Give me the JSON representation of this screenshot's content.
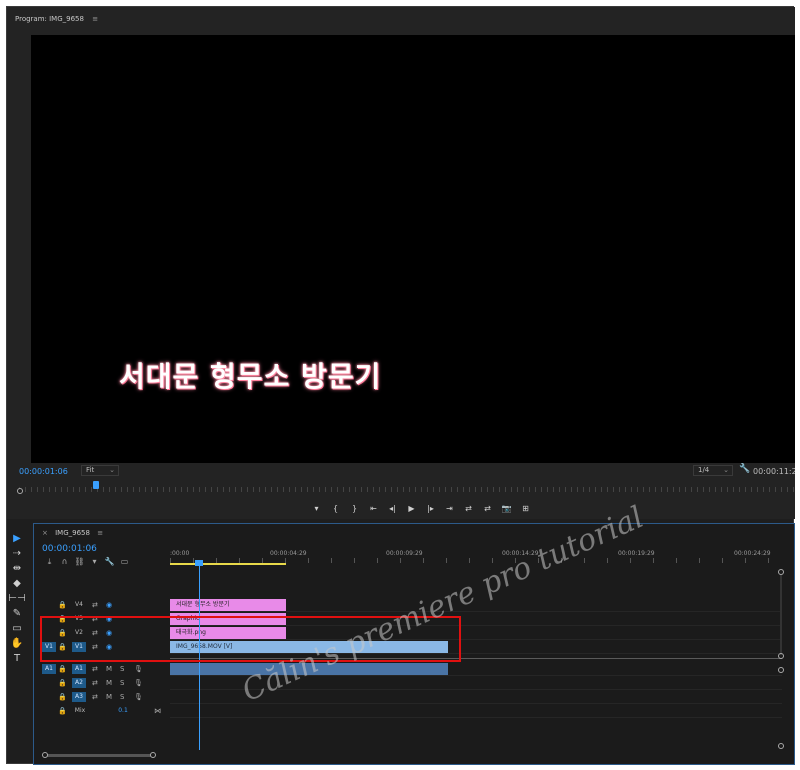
{
  "program": {
    "tab_title": "Program: IMG_9658",
    "menu": "≡",
    "title_overlay": "서대문 형무소 방문기",
    "timecode_left": "00:00:01:06",
    "fit_label": "Fit",
    "resolution": "1/4",
    "timecode_right": "00:00:11:2",
    "transport": [
      "▾",
      "{",
      "}",
      "⇤",
      "◂|",
      "▶",
      "|▸",
      "⇥",
      "⇄",
      "⇄",
      "📷",
      "⊞"
    ]
  },
  "timeline": {
    "tab_title": "IMG_9658",
    "close": "×",
    "menu": "≡",
    "timecode": "00:00:01:06",
    "ruler_labels": [
      ":00:00",
      "00:00:04:29",
      "00:00:09:29",
      "00:00:14:29",
      "00:00:19:29",
      "00:00:24:29"
    ],
    "tracks": {
      "v4": "V4",
      "v3": "V3",
      "v2": "V2",
      "v1": "V1",
      "a1": "A1",
      "a2": "A2",
      "a3": "A3",
      "src_v1": "V1",
      "src_a1": "A1",
      "mix": "Mix",
      "mix_value": "0.1"
    },
    "clips": {
      "v4": "서대문 형무소 방문기",
      "v3": "Graphic",
      "v2": "태극화.png",
      "v1": "IMG_9658.MOV [V]"
    }
  },
  "tools": [
    "▶",
    "⇢",
    "⇹",
    "◆",
    "⊢⊣",
    "✎",
    "▭",
    "✋",
    "T"
  ],
  "watermark": "Călin's premiere pro tutorial",
  "colors": {
    "accent": "#3aa0ff",
    "clip_pink": "#e88ae8",
    "clip_blue": "#8ab8e6",
    "highlight_box": "#e01010"
  }
}
